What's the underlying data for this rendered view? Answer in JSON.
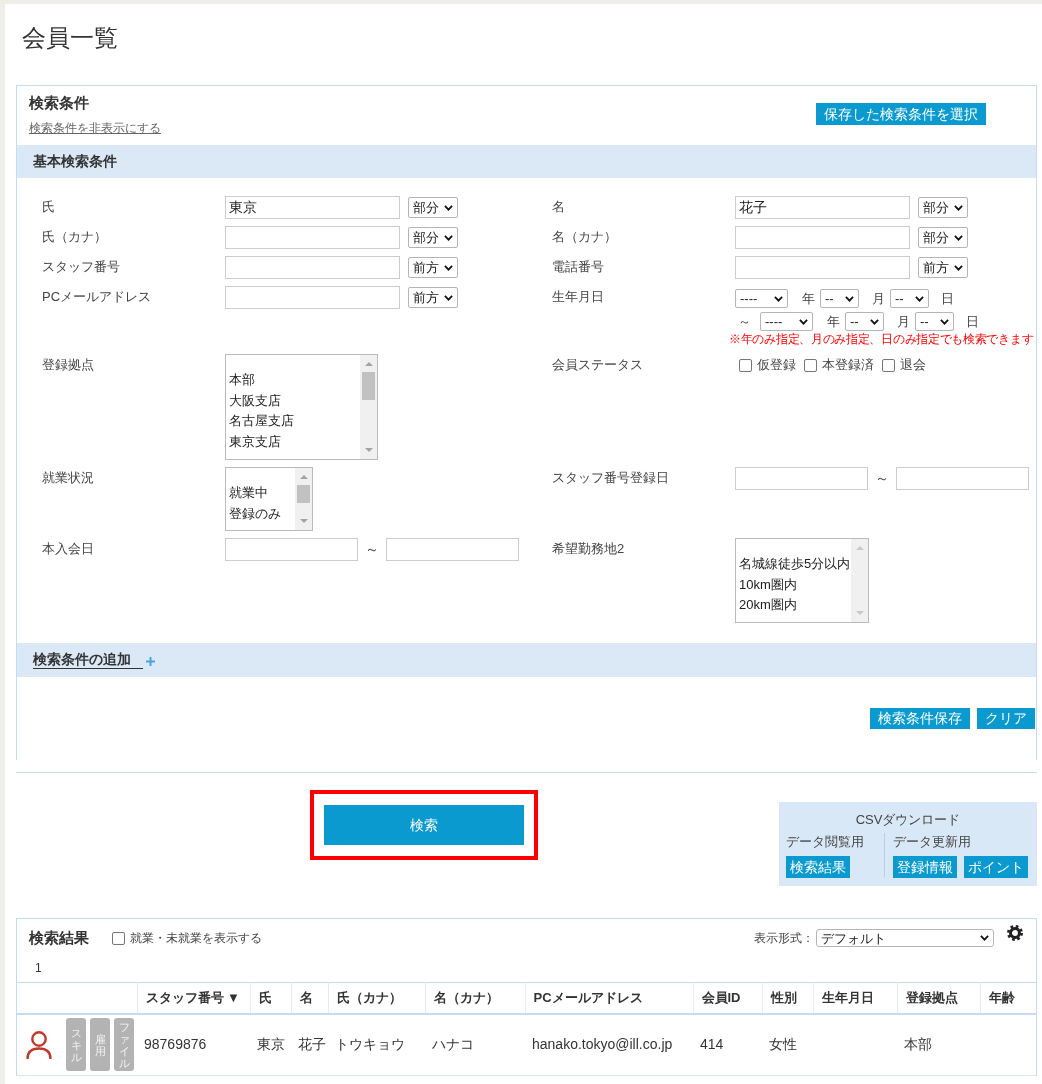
{
  "page_title": "会員一覧",
  "search_panel": {
    "title": "検索条件",
    "hide_link": "検索条件を非表示にする",
    "saved_conditions_button": "保存した検索条件を選択",
    "basic_section": {
      "heading": "基本検索条件",
      "fields": [
        {
          "kind": "text",
          "label": "氏",
          "value": "東京",
          "match": "部分"
        },
        {
          "kind": "text",
          "label": "名",
          "value": "花子",
          "match": "部分"
        },
        {
          "kind": "text",
          "label": "氏（カナ）",
          "match": "部分"
        },
        {
          "kind": "text",
          "label": "名（カナ）",
          "match": "部分"
        },
        {
          "kind": "text",
          "label": "スタッフ番号",
          "match": "前方"
        },
        {
          "kind": "text",
          "label": "電話番号",
          "match": "前方"
        },
        {
          "kind": "text",
          "label": "PCメールアドレス",
          "match": "前方"
        },
        {
          "kind": "date_range",
          "label": "生年月日",
          "from": {
            "year": "----",
            "year_unit": "年",
            "month": "--",
            "month_unit": "月",
            "day": "--",
            "day_unit": "日"
          },
          "separator": "～",
          "to": {
            "year": "----",
            "year_unit": "年",
            "month": "--",
            "month_unit": "月",
            "day": "--",
            "day_unit": "日"
          },
          "note": "※年のみ指定、月のみ指定、日のみ指定でも検索できます"
        },
        {
          "kind": "listbox",
          "label": "登録拠点",
          "options": [
            "本部",
            "大阪支店",
            "名古屋支店",
            "東京支店"
          ]
        },
        {
          "kind": "checkboxes",
          "label": "会員ステータス",
          "options": [
            {
              "label": "仮登録",
              "checked": false
            },
            {
              "label": "本登録済",
              "checked": false
            },
            {
              "label": "退会",
              "checked": false
            }
          ]
        },
        {
          "kind": "listbox",
          "label": "就業状況",
          "options": [
            "就業中",
            "登録のみ"
          ]
        },
        {
          "kind": "range",
          "label": "スタッフ番号登録日",
          "separator": "～"
        },
        {
          "kind": "range",
          "label": "本入会日",
          "separator": "～"
        },
        {
          "kind": "listbox",
          "label": "希望勤務地2",
          "options": [
            "名城線徒歩5分以内",
            "10km圏内",
            "20km圏内"
          ]
        }
      ]
    },
    "add_section": {
      "heading": "検索条件の追加"
    },
    "buttons": [
      "検索条件保存",
      "クリア"
    ]
  },
  "search_button": {
    "label": "検索",
    "highlighted": true
  },
  "csv_download": {
    "title": "CSVダウンロード",
    "groups": [
      {
        "label": "データ閲覧用",
        "buttons": [
          "検索結果"
        ]
      },
      {
        "label": "データ更新用",
        "buttons": [
          "登録情報",
          "ポイント"
        ]
      }
    ]
  },
  "results": {
    "title": "検索結果",
    "show_all": {
      "label": "就業・未就業を表示する",
      "checked": false
    },
    "format_label": "表示形式：",
    "format_value": "デフォルト",
    "pagination": [
      "1"
    ],
    "columns": [
      {
        "label": "スタッフ番号",
        "sort_indicator": "▼"
      },
      {
        "label": "氏"
      },
      {
        "label": "名"
      },
      {
        "label": "氏（カナ）"
      },
      {
        "label": "名（カナ）"
      },
      {
        "label": "PCメールアドレス"
      },
      {
        "label": "会員ID"
      },
      {
        "label": "性別"
      },
      {
        "label": "生年月日"
      },
      {
        "label": "登録拠点"
      },
      {
        "label": "年齢"
      }
    ],
    "rows": [
      {
        "tags": [
          {
            "label": "スキル",
            "active": false
          },
          {
            "label": "雇用",
            "active": false
          },
          {
            "label": "ファイル",
            "active": false
          }
        ],
        "cells": [
          "98769876",
          "東京",
          "花子",
          "トウキョウ",
          "ハナコ",
          "hanako.tokyo@ill.co.jp",
          "414",
          "女性",
          null,
          "本部",
          null
        ]
      }
    ]
  }
}
